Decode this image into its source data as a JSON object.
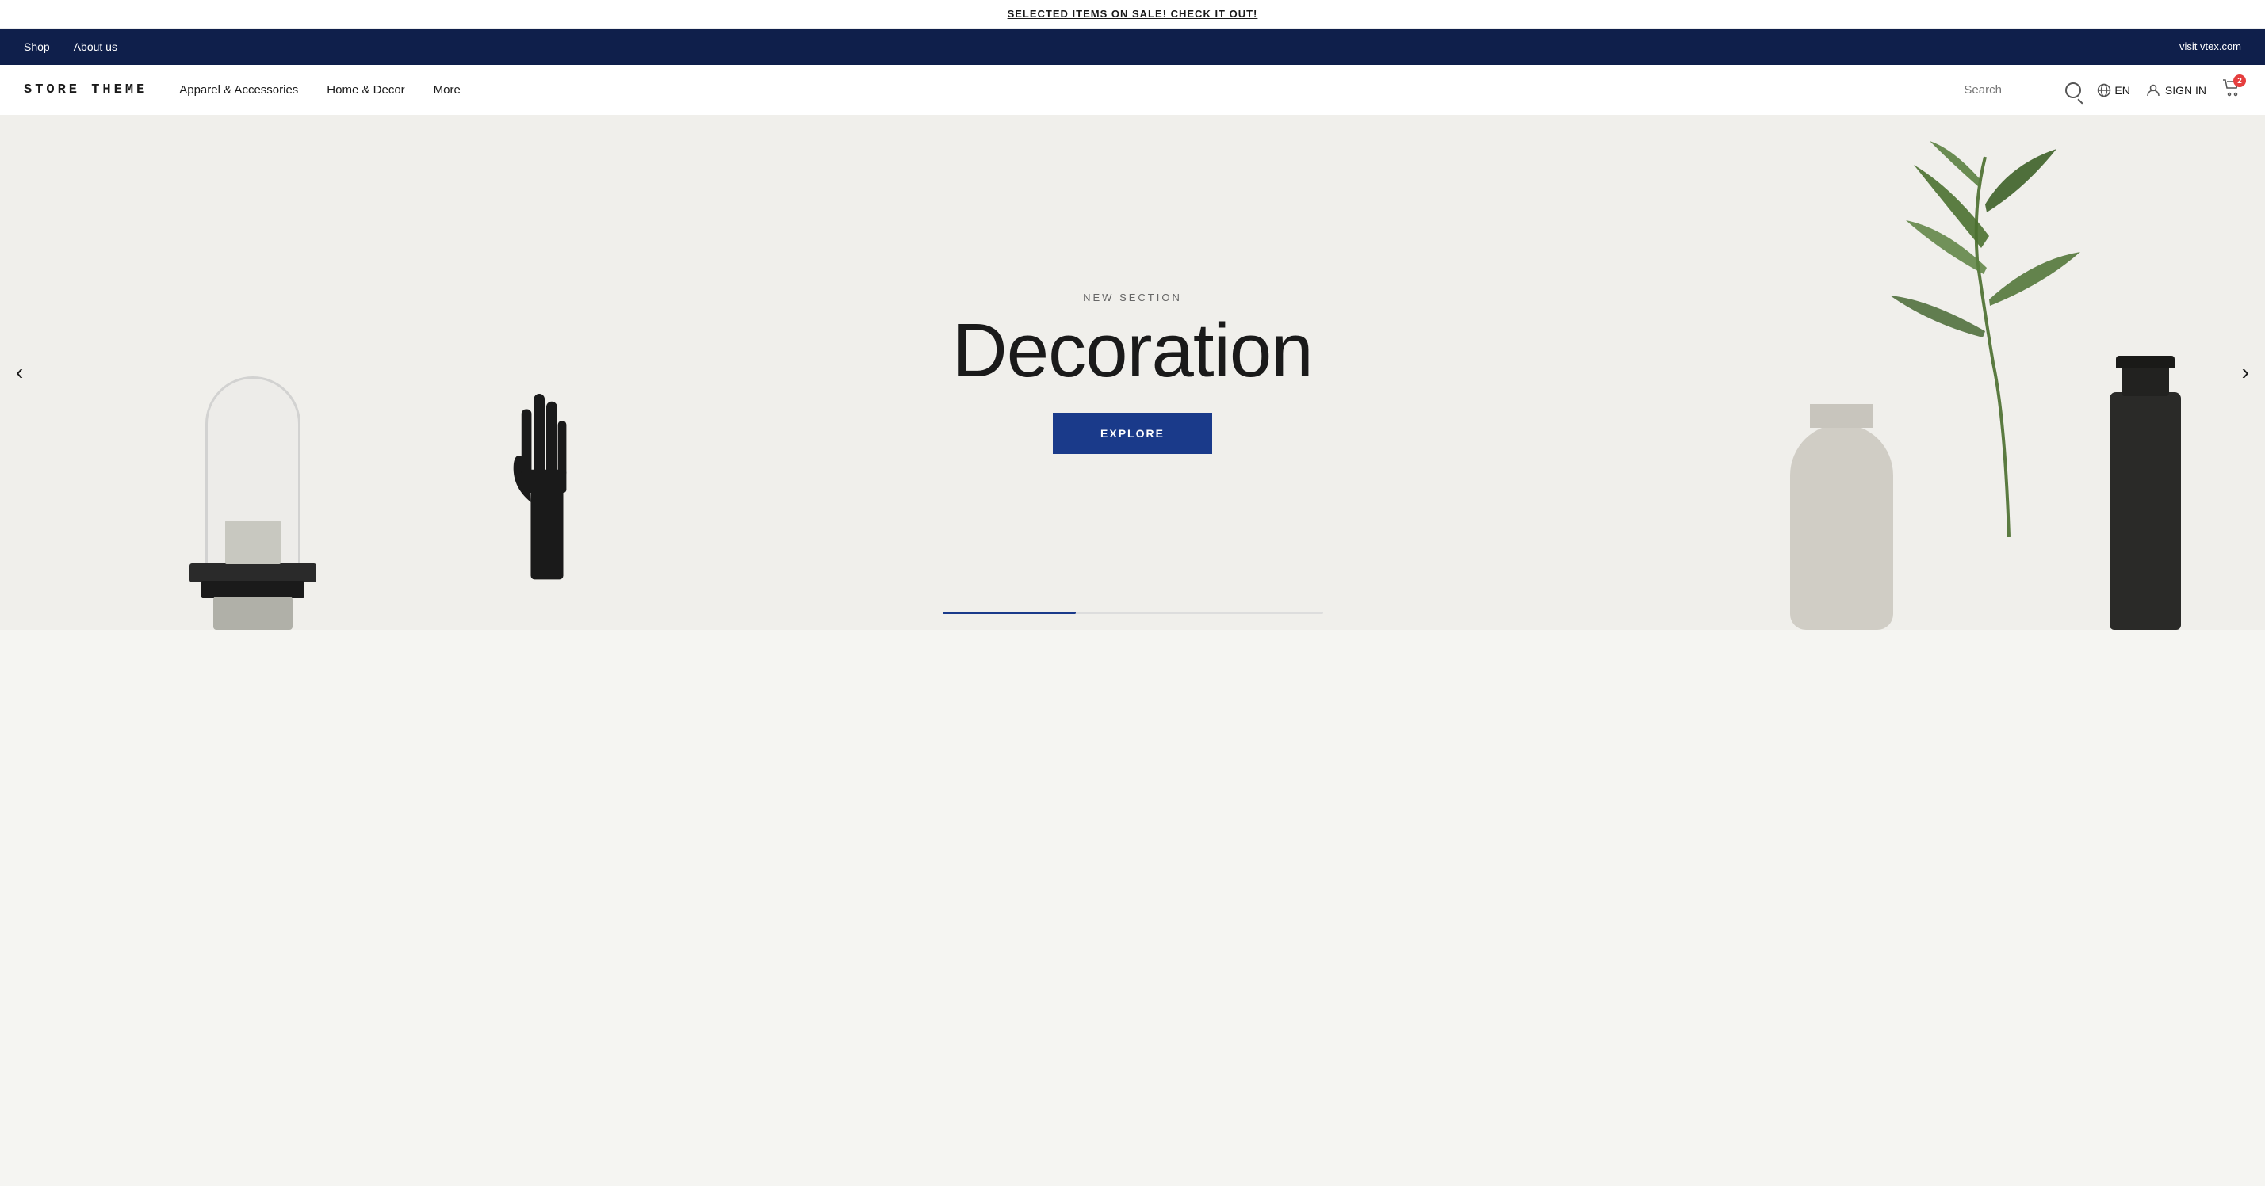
{
  "announcement": {
    "text": "SELECTED ITEMS ON SALE! CHECK IT OUT!"
  },
  "top_nav": {
    "left_links": [
      {
        "label": "Shop",
        "href": "#"
      },
      {
        "label": "About us",
        "href": "#"
      }
    ],
    "right_link": {
      "label": "visit vtex.com",
      "href": "#"
    }
  },
  "header": {
    "logo": "STORE THEME",
    "nav_items": [
      {
        "label": "Apparel & Accessories"
      },
      {
        "label": "Home & Decor"
      },
      {
        "label": "More"
      }
    ],
    "search_placeholder": "Search",
    "lang": "EN",
    "sign_in_label": "SIGN IN",
    "cart_badge": "2"
  },
  "hero": {
    "subtitle": "NEW SECTION",
    "title": "Decoration",
    "cta_label": "EXPLORE"
  },
  "carousel": {
    "prev_label": "‹",
    "next_label": "›"
  },
  "colors": {
    "top_nav_bg": "#0f1f4b",
    "explore_btn": "#1a3a8a",
    "cart_badge": "#e53e3e",
    "hero_bg": "#f0efeb"
  }
}
